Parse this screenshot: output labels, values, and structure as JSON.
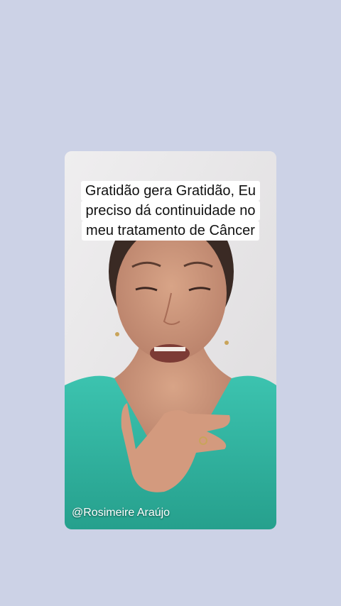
{
  "background_color": "#ccd2e6",
  "video": {
    "caption_lines": [
      "Gratidão gera Gratidão, Eu",
      "preciso dá continuidade no",
      "meu tratamento de Câncer"
    ],
    "username": "@Rosimeire Araújo",
    "shirt_color": "#32b9a5"
  }
}
